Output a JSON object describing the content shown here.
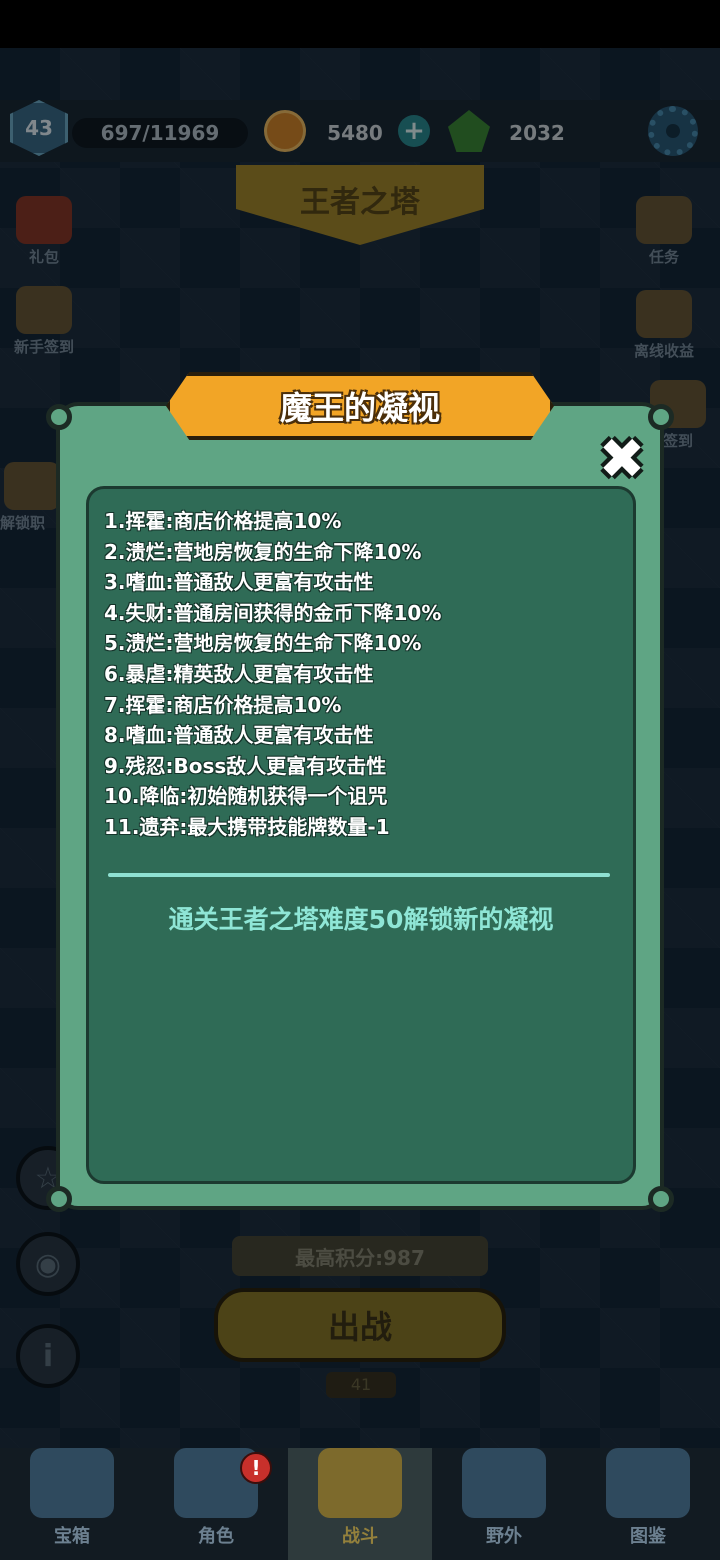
{
  "hud": {
    "level": "43",
    "xp": "697/11969",
    "coins": "5480",
    "gems": "2032",
    "plus": "+"
  },
  "tower_title": "王者之塔",
  "left_side": [
    {
      "label": "礼包",
      "icon": "gift-icon"
    },
    {
      "label": "新手签到",
      "icon": "scroll-icon"
    },
    {
      "label": "解锁职",
      "icon": "unlock-icon"
    }
  ],
  "right_side": [
    {
      "label": "任务",
      "icon": "task-icon"
    },
    {
      "label": "离线收益",
      "icon": "offline-reward-icon"
    },
    {
      "label": "签到",
      "icon": "checkin-icon"
    }
  ],
  "score_text": "最高积分:987",
  "fight_label": "出战",
  "under_number": "41",
  "bottom_nav": [
    {
      "label": "宝箱",
      "icon": "treasure-chest-icon"
    },
    {
      "label": "角色",
      "icon": "character-icon",
      "badge": "!"
    },
    {
      "label": "战斗",
      "icon": "battle-icon",
      "active": true
    },
    {
      "label": "野外",
      "icon": "castle-icon"
    },
    {
      "label": "图鉴",
      "icon": "book-icon"
    }
  ],
  "dialog": {
    "title": "魔王的凝视",
    "close_symbol": "✖",
    "items": [
      "1.挥霍:商店价格提高10%",
      "2.溃烂:营地房恢复的生命下降10%",
      "3.嗜血:普通敌人更富有攻击性",
      "4.失财:普通房间获得的金币下降10%",
      "5.溃烂:营地房恢复的生命下降10%",
      "6.暴虐:精英敌人更富有攻击性",
      "7.挥霍:商店价格提高10%",
      "8.嗜血:普通敌人更富有攻击性",
      "9.残忍:Boss敌人更富有攻击性",
      "10.降临:初始随机获得一个诅咒",
      "11.遗弃:最大携带技能牌数量-1"
    ],
    "unlock_hint": "通关王者之塔难度50解锁新的凝视"
  },
  "colors": {
    "dialog_outer": "#5fa584",
    "dialog_inner": "#2f6b56",
    "title_banner": "#f2a526",
    "hint_text": "#8fe6d6"
  }
}
